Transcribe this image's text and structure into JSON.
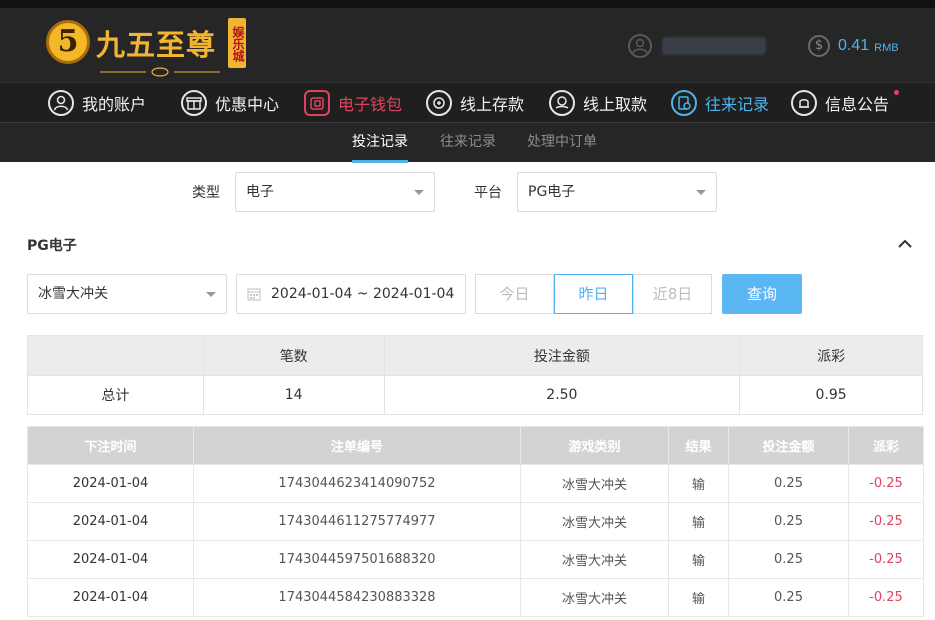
{
  "brand": {
    "logo_text": "九五至尊",
    "logo_tag": "娱乐城",
    "logo_digit": "5"
  },
  "account": {
    "username_masked": "",
    "balance_amount": "0.41",
    "balance_unit": "RMB",
    "coin_symbol": "$"
  },
  "nav": {
    "items": [
      {
        "label": "我的账户",
        "icon": "user-icon"
      },
      {
        "label": "优惠中心",
        "icon": "gift-icon"
      },
      {
        "label": "电子钱包",
        "icon": "wallet-icon"
      },
      {
        "label": "线上存款",
        "icon": "deposit-icon"
      },
      {
        "label": "线上取款",
        "icon": "withdraw-icon"
      },
      {
        "label": "往来记录",
        "icon": "records-icon"
      },
      {
        "label": "信息公告",
        "icon": "bell-icon"
      }
    ],
    "active": "往来记录",
    "wallet_color": "#e0435f",
    "active_color": "#4fb3f0"
  },
  "subtabs": {
    "items": [
      "投注记录",
      "往来记录",
      "处理中订单"
    ],
    "active": "投注记录"
  },
  "filters": {
    "type_label": "类型",
    "type_value": "电子",
    "platform_label": "平台",
    "platform_value": "PG电子",
    "section_title": "PG电子",
    "game_value": "冰雪大冲关",
    "date_range": "2024-01-04 ~ 2024-01-04",
    "quick_ranges": [
      "今日",
      "昨日",
      "近8日"
    ],
    "quick_active": "昨日",
    "query_label": "查询"
  },
  "summary": {
    "headers": [
      "",
      "笔数",
      "投注金额",
      "派彩"
    ],
    "row": [
      "总计",
      "14",
      "2.50",
      "0.95"
    ]
  },
  "bets": {
    "headers": [
      "下注时间",
      "注单编号",
      "游戏类别",
      "结果",
      "投注金额",
      "派彩"
    ],
    "rows": [
      [
        "2024-01-04",
        "1743044623414090752",
        "冰雪大冲关",
        "输",
        "0.25",
        "-0.25"
      ],
      [
        "2024-01-04",
        "1743044611275774977",
        "冰雪大冲关",
        "输",
        "0.25",
        "-0.25"
      ],
      [
        "2024-01-04",
        "1743044597501688320",
        "冰雪大冲关",
        "输",
        "0.25",
        "-0.25"
      ],
      [
        "2024-01-04",
        "1743044584230883328",
        "冰雪大冲关",
        "输",
        "0.25",
        "-0.25"
      ]
    ]
  }
}
